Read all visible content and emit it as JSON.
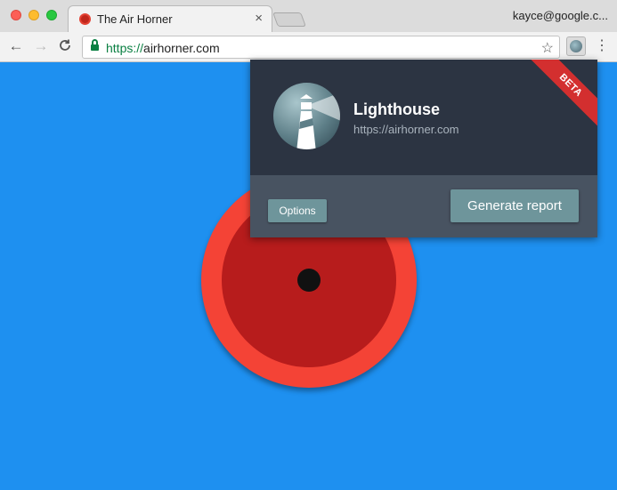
{
  "browser": {
    "tab": {
      "title": "The Air Horner",
      "close_label": "×",
      "favicon": "air-horner-favicon"
    },
    "profile_label": "kayce@google.c...",
    "toolbar": {
      "back_icon": "←",
      "forward_icon": "→",
      "reload_icon": "C",
      "url_scheme": "https://",
      "url_host": "airhorner.com",
      "star_icon": "☆",
      "menu_icon": "⋮"
    }
  },
  "lighthouse_popup": {
    "title": "Lighthouse",
    "url": "https://airhorner.com",
    "badge": "BETA",
    "options_button": "Options",
    "generate_button": "Generate report"
  },
  "colors": {
    "page_background": "#1e90f0",
    "horn_outer": "#f44336",
    "horn_inner": "#b71c1c",
    "popup_header": "#2c3442",
    "popup_footer": "#485361",
    "button": "#6e959b",
    "beta_ribbon": "#d32f2f",
    "secure_green": "#0b8043"
  }
}
